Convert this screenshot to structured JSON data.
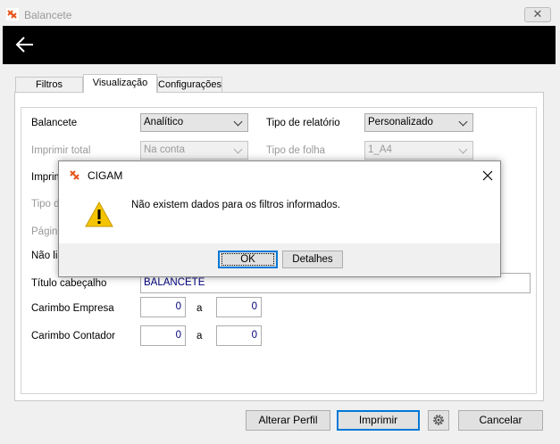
{
  "window": {
    "title": "Balancete",
    "close_glyph": "✕"
  },
  "tabs": [
    {
      "label": "Filtros"
    },
    {
      "label": "Visualização"
    },
    {
      "label": "Configurações"
    }
  ],
  "form": {
    "balancete_label": "Balancete",
    "balancete_value": "Analítico",
    "tipo_relatorio_label": "Tipo de relatório",
    "tipo_relatorio_value": "Personalizado",
    "imprimir_total_label": "Imprimir total",
    "imprimir_total_value": "Na conta",
    "tipo_folha_label": "Tipo de folha",
    "tipo_folha_value": "1_A4",
    "row3_label_partial": "Imprim",
    "row4_label_partial": "Tipo d",
    "row5_label_partial": "Págin",
    "row6_label_partial": "Não lis",
    "titulo_label": "Título cabeçalho",
    "titulo_value": "BALANCETE",
    "carimbo_empresa_label": "Carimbo Empresa",
    "carimbo_empresa_from": "0",
    "carimbo_empresa_to": "0",
    "carimbo_contador_label": "Carimbo Contador",
    "carimbo_contador_from": "0",
    "carimbo_contador_to": "0",
    "range_sep": "a"
  },
  "footer": {
    "alterar_perfil": "Alterar Perfil",
    "imprimir": "Imprimir",
    "cancelar": "Cancelar"
  },
  "dialog": {
    "title": "CIGAM",
    "message": "Não existem dados para os filtros informados.",
    "ok": "OK",
    "detalhes": "Detalhes"
  },
  "colors": {
    "accent": "#0078d7",
    "header_bar": "#000000",
    "warning": "#f5c400",
    "brand": "#e8541c"
  }
}
